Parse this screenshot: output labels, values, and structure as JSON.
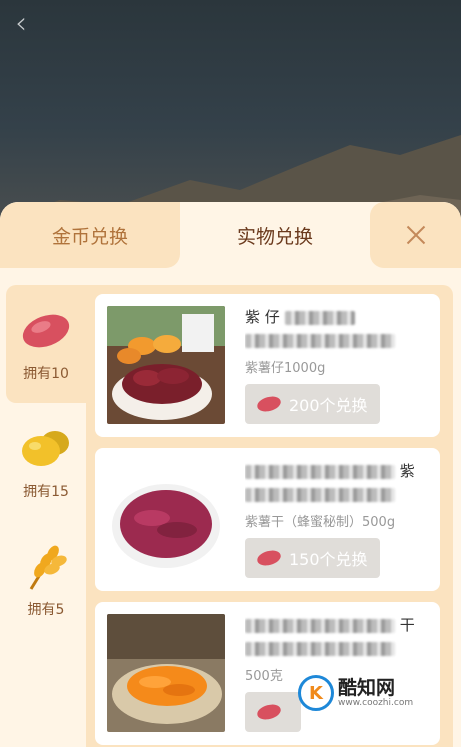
{
  "tabs": {
    "left": "金币兑换",
    "active": "实物兑换"
  },
  "sidebar": {
    "items": [
      {
        "label": "拥有10",
        "icon": "sweet-potato-icon"
      },
      {
        "label": "拥有15",
        "icon": "potato-icon"
      },
      {
        "label": "拥有5",
        "icon": "wheat-icon"
      }
    ]
  },
  "products": [
    {
      "title_line1": "紫   仔",
      "title_line2": "1    ...",
      "subtitle": "紫薯仔1000g",
      "button": "200个兑换",
      "image": "dried-sweet-potato-image"
    },
    {
      "title_line1": "紫",
      "title_line2": "...",
      "subtitle": "紫薯干（蜂蜜秘制）500g",
      "button": "150个兑换",
      "image": "purple-sweet-potato-strips-image"
    },
    {
      "title_line1": "干",
      "title_line2": "...",
      "subtitle": "500克",
      "button": "",
      "image": "orange-sweet-potato-strips-image"
    }
  ],
  "watermark": {
    "logo": "K",
    "main": "酷知网",
    "url": "www.coozhi.com"
  },
  "colors": {
    "panel_bg": "#fff5e6",
    "tab_inactive": "#fbe3c0",
    "tab_text": "#b0733b",
    "button_bg": "#e0ddd9"
  }
}
